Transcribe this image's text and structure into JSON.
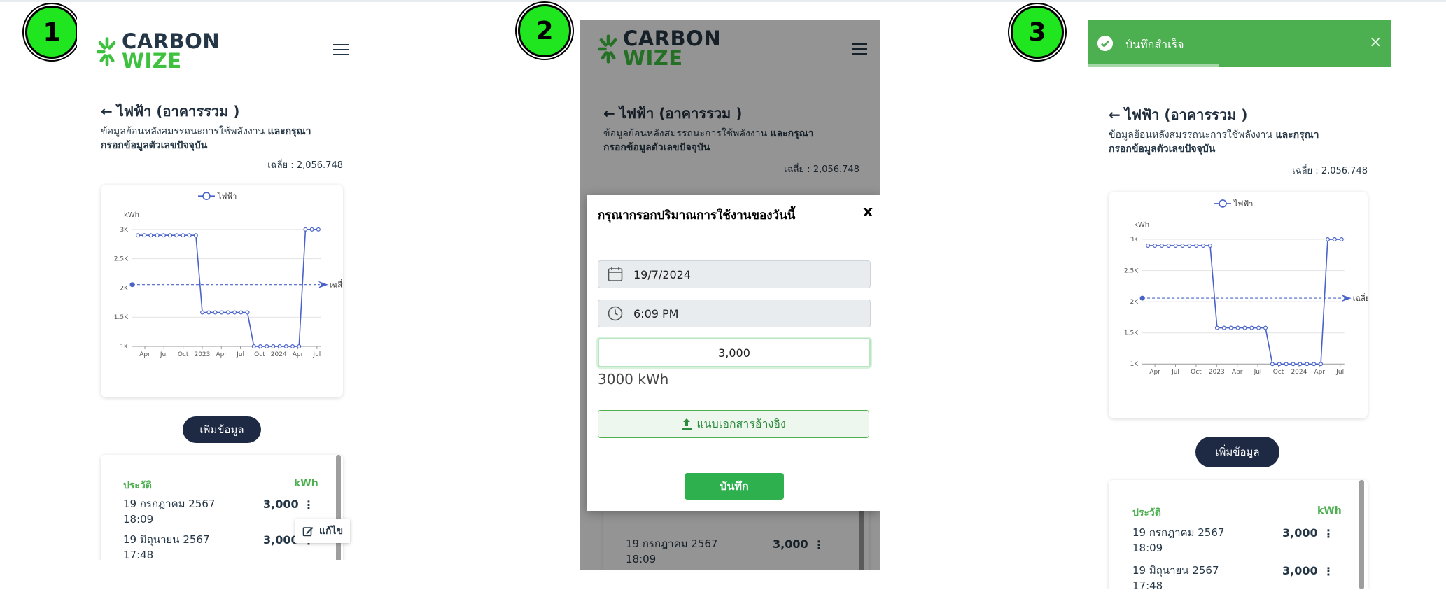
{
  "steps": [
    "1",
    "2",
    "3"
  ],
  "app": {
    "logo_line1": "CARBON",
    "logo_line2": "WIZE"
  },
  "page": {
    "back_arrow": "←",
    "title": "ไฟฟ้า (อาคารรวม )",
    "subtitle_plain": "ข้อมูลย้อนหลังสมรรถนะการใช้พลังงาน ",
    "subtitle_bold_1": "และกรุณา",
    "subtitle_bold_2": "กรอกข้อมูลตัวเลขปัจจุบัน",
    "subtitle_line1_plain": "ข้อมูลย้อนหลังสมรรถนะการใช้พลังงาน",
    "average_label": "เฉลี่ย : 2,056.748"
  },
  "chart_data": {
    "type": "line",
    "title": "",
    "legend": "ไฟฟ้า",
    "legend_position": "top-center",
    "ylabel": "kWh",
    "yticks": [
      "1K",
      "1.5K",
      "2K",
      "2.5K",
      "3K"
    ],
    "ylim": [
      1000,
      3000
    ],
    "xticks": [
      "Apr",
      "Jul",
      "Oct",
      "2023",
      "Apr",
      "Jul",
      "Oct",
      "2024",
      "Apr",
      "Jul"
    ],
    "series": [
      {
        "name": "ไฟฟ้า",
        "values": [
          2900,
          2900,
          2900,
          2900,
          2900,
          2900,
          2900,
          2900,
          2900,
          2900,
          1580,
          1580,
          1580,
          1580,
          1580,
          1580,
          1580,
          1580,
          1000,
          1000,
          1000,
          1000,
          1000,
          1000,
          1000,
          1000,
          3000,
          3000,
          3000
        ]
      }
    ],
    "average": {
      "label": "เฉลี่ย",
      "value": 2056.748
    },
    "grid": true,
    "color": "#4a63c9"
  },
  "add_button": "เพิ่มข้อมูล",
  "history": {
    "header_left": "ประวัติ",
    "header_right": "kWh",
    "rows": [
      {
        "date": "19 กรกฎาคม 2567",
        "time": "18:09",
        "value": "3,000"
      },
      {
        "date": "19 มิถุนายน 2567",
        "time": "17:48",
        "value": "3,000"
      }
    ],
    "kebab": "⋮",
    "edit_label": "แก้ไข"
  },
  "modal": {
    "title": "กรุณากรอกปริมาณการใช้งานของวันนี้",
    "close": "x",
    "date_value": "19/7/2024",
    "time_value": "6:09 PM",
    "amount_value": "3,000",
    "amount_unit_text": "3000 kWh",
    "upload_label": "แนบเอกสารอ้างอิง",
    "save_label": "บันทึก"
  },
  "toast": {
    "message": "บันทึกสำเร็จ",
    "close": "×",
    "progress": 0.43
  },
  "colors": {
    "brand_dark": "#253746",
    "brand_green": "#3ec13e",
    "navy_button": "#1e2a44",
    "success": "#4caf50",
    "series": "#4a63c9"
  }
}
